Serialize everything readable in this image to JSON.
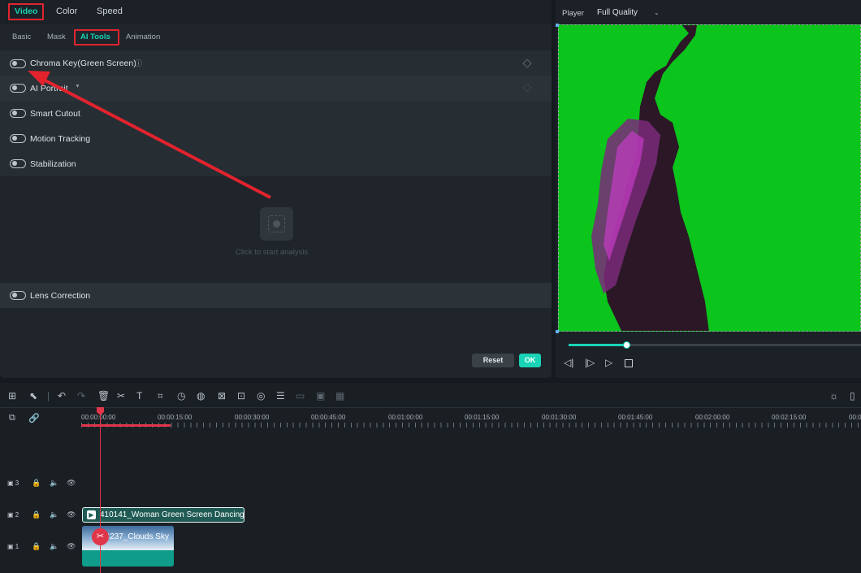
{
  "top_tabs": [
    {
      "label": "Video"
    },
    {
      "label": "Color"
    },
    {
      "label": "Speed"
    }
  ],
  "sub_tabs": [
    {
      "label": "Basic"
    },
    {
      "label": "Mask"
    },
    {
      "label": "AI Tools"
    },
    {
      "label": "Animation"
    }
  ],
  "ai_tools": {
    "items": [
      {
        "label": "Chroma Key(Green Screen)",
        "enabled": false
      },
      {
        "label": "AI Portrait",
        "enabled": false
      },
      {
        "label": "Smart Cutout",
        "enabled": false
      },
      {
        "label": "Motion Tracking",
        "enabled": false
      },
      {
        "label": "Stabilization",
        "enabled": false
      }
    ],
    "analysis_hint": "Click to start analysis",
    "lens": {
      "label": "Lens Correction",
      "enabled": false
    }
  },
  "buttons": {
    "reset": "Reset",
    "ok": "OK"
  },
  "player": {
    "label": "Player",
    "quality": "Full Quality",
    "progress": 0.2
  },
  "timeline": {
    "timecodes": [
      "00:00:00:00",
      "00:00:15:00",
      "00:00:30:00",
      "00:00:45:00",
      "00:01:00:00",
      "00:01:15:00",
      "00:01:30:00",
      "00:01:45:00",
      "00:02:00:00",
      "00:02:15:00",
      "00:0"
    ],
    "tracks": [
      {
        "num": "3"
      },
      {
        "num": "2"
      },
      {
        "num": "1"
      }
    ],
    "clips": {
      "track2": "410141_Woman Green Screen Dancing",
      "track1": "94237_Clouds Sky"
    }
  },
  "colors": {
    "accent": "#18d3b5",
    "highlight": "#e0252f",
    "green_screen": "#0bc41c",
    "playhead": "#e0364a"
  }
}
